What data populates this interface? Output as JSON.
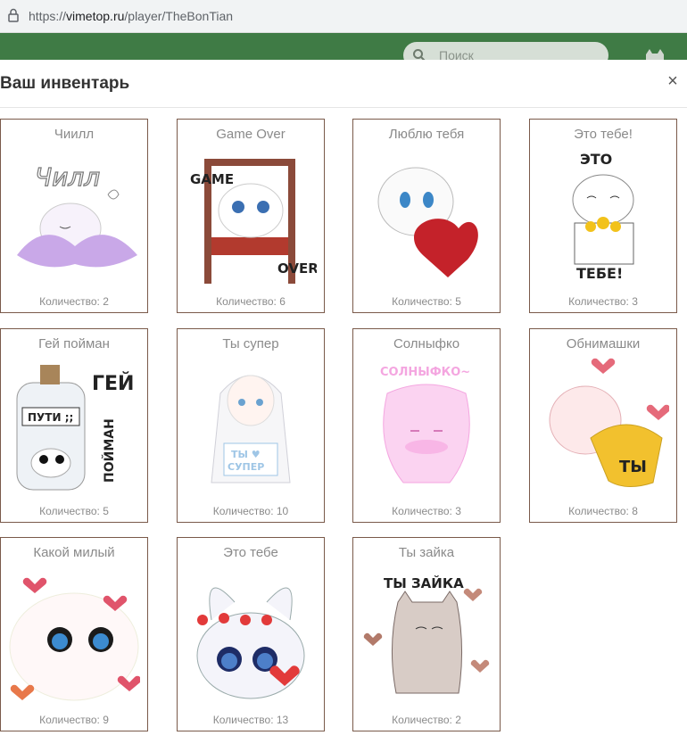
{
  "browser": {
    "url_prefix": "https://",
    "url_domain": "vimetop.ru",
    "url_path": "/player/TheBonTian"
  },
  "site": {
    "search_placeholder": "Поиск"
  },
  "modal": {
    "title": "Ваш инвентарь",
    "close_label": "×"
  },
  "items": [
    {
      "name": "Чиилл",
      "quantity": "Количество: 2",
      "sticker_text": "Чилл",
      "color": "#c9a8e8"
    },
    {
      "name": "Game Over",
      "quantity": "Количество: 6",
      "sticker_text": "GAME OVER",
      "color": "#b23a2e"
    },
    {
      "name": "Люблю тебя",
      "quantity": "Количество: 5",
      "sticker_text": "",
      "color": "#c4222a"
    },
    {
      "name": "Это тебе!",
      "quantity": "Количество: 3",
      "sticker_text": "ЭТО ТЕБЕ!",
      "color": "#f2c21b"
    },
    {
      "name": "Гей пойман",
      "quantity": "Количество: 5",
      "sticker_text": "ГЕЙ ПОЙМАН",
      "color": "#222222"
    },
    {
      "name": "Ты супер",
      "quantity": "Количество: 10",
      "sticker_text": "ТЫ СУПЕР",
      "color": "#9fc6e6"
    },
    {
      "name": "Солныфко",
      "quantity": "Количество: 3",
      "sticker_text": "СОЛНЫФКО~",
      "color": "#f4a6e0"
    },
    {
      "name": "Обнимашки",
      "quantity": "Количество: 8",
      "sticker_text": "ТЫ",
      "color": "#f2c12e"
    },
    {
      "name": "Какой милый",
      "quantity": "Количество: 9",
      "sticker_text": "",
      "color": "#e0546b"
    },
    {
      "name": "Это тебе",
      "quantity": "Количество: 13",
      "sticker_text": "",
      "color": "#e23a3a"
    },
    {
      "name": "Ты зайка",
      "quantity": "Количество: 2",
      "sticker_text": "ТЫ ЗАЙКА",
      "color": "#c9b8b3"
    }
  ]
}
